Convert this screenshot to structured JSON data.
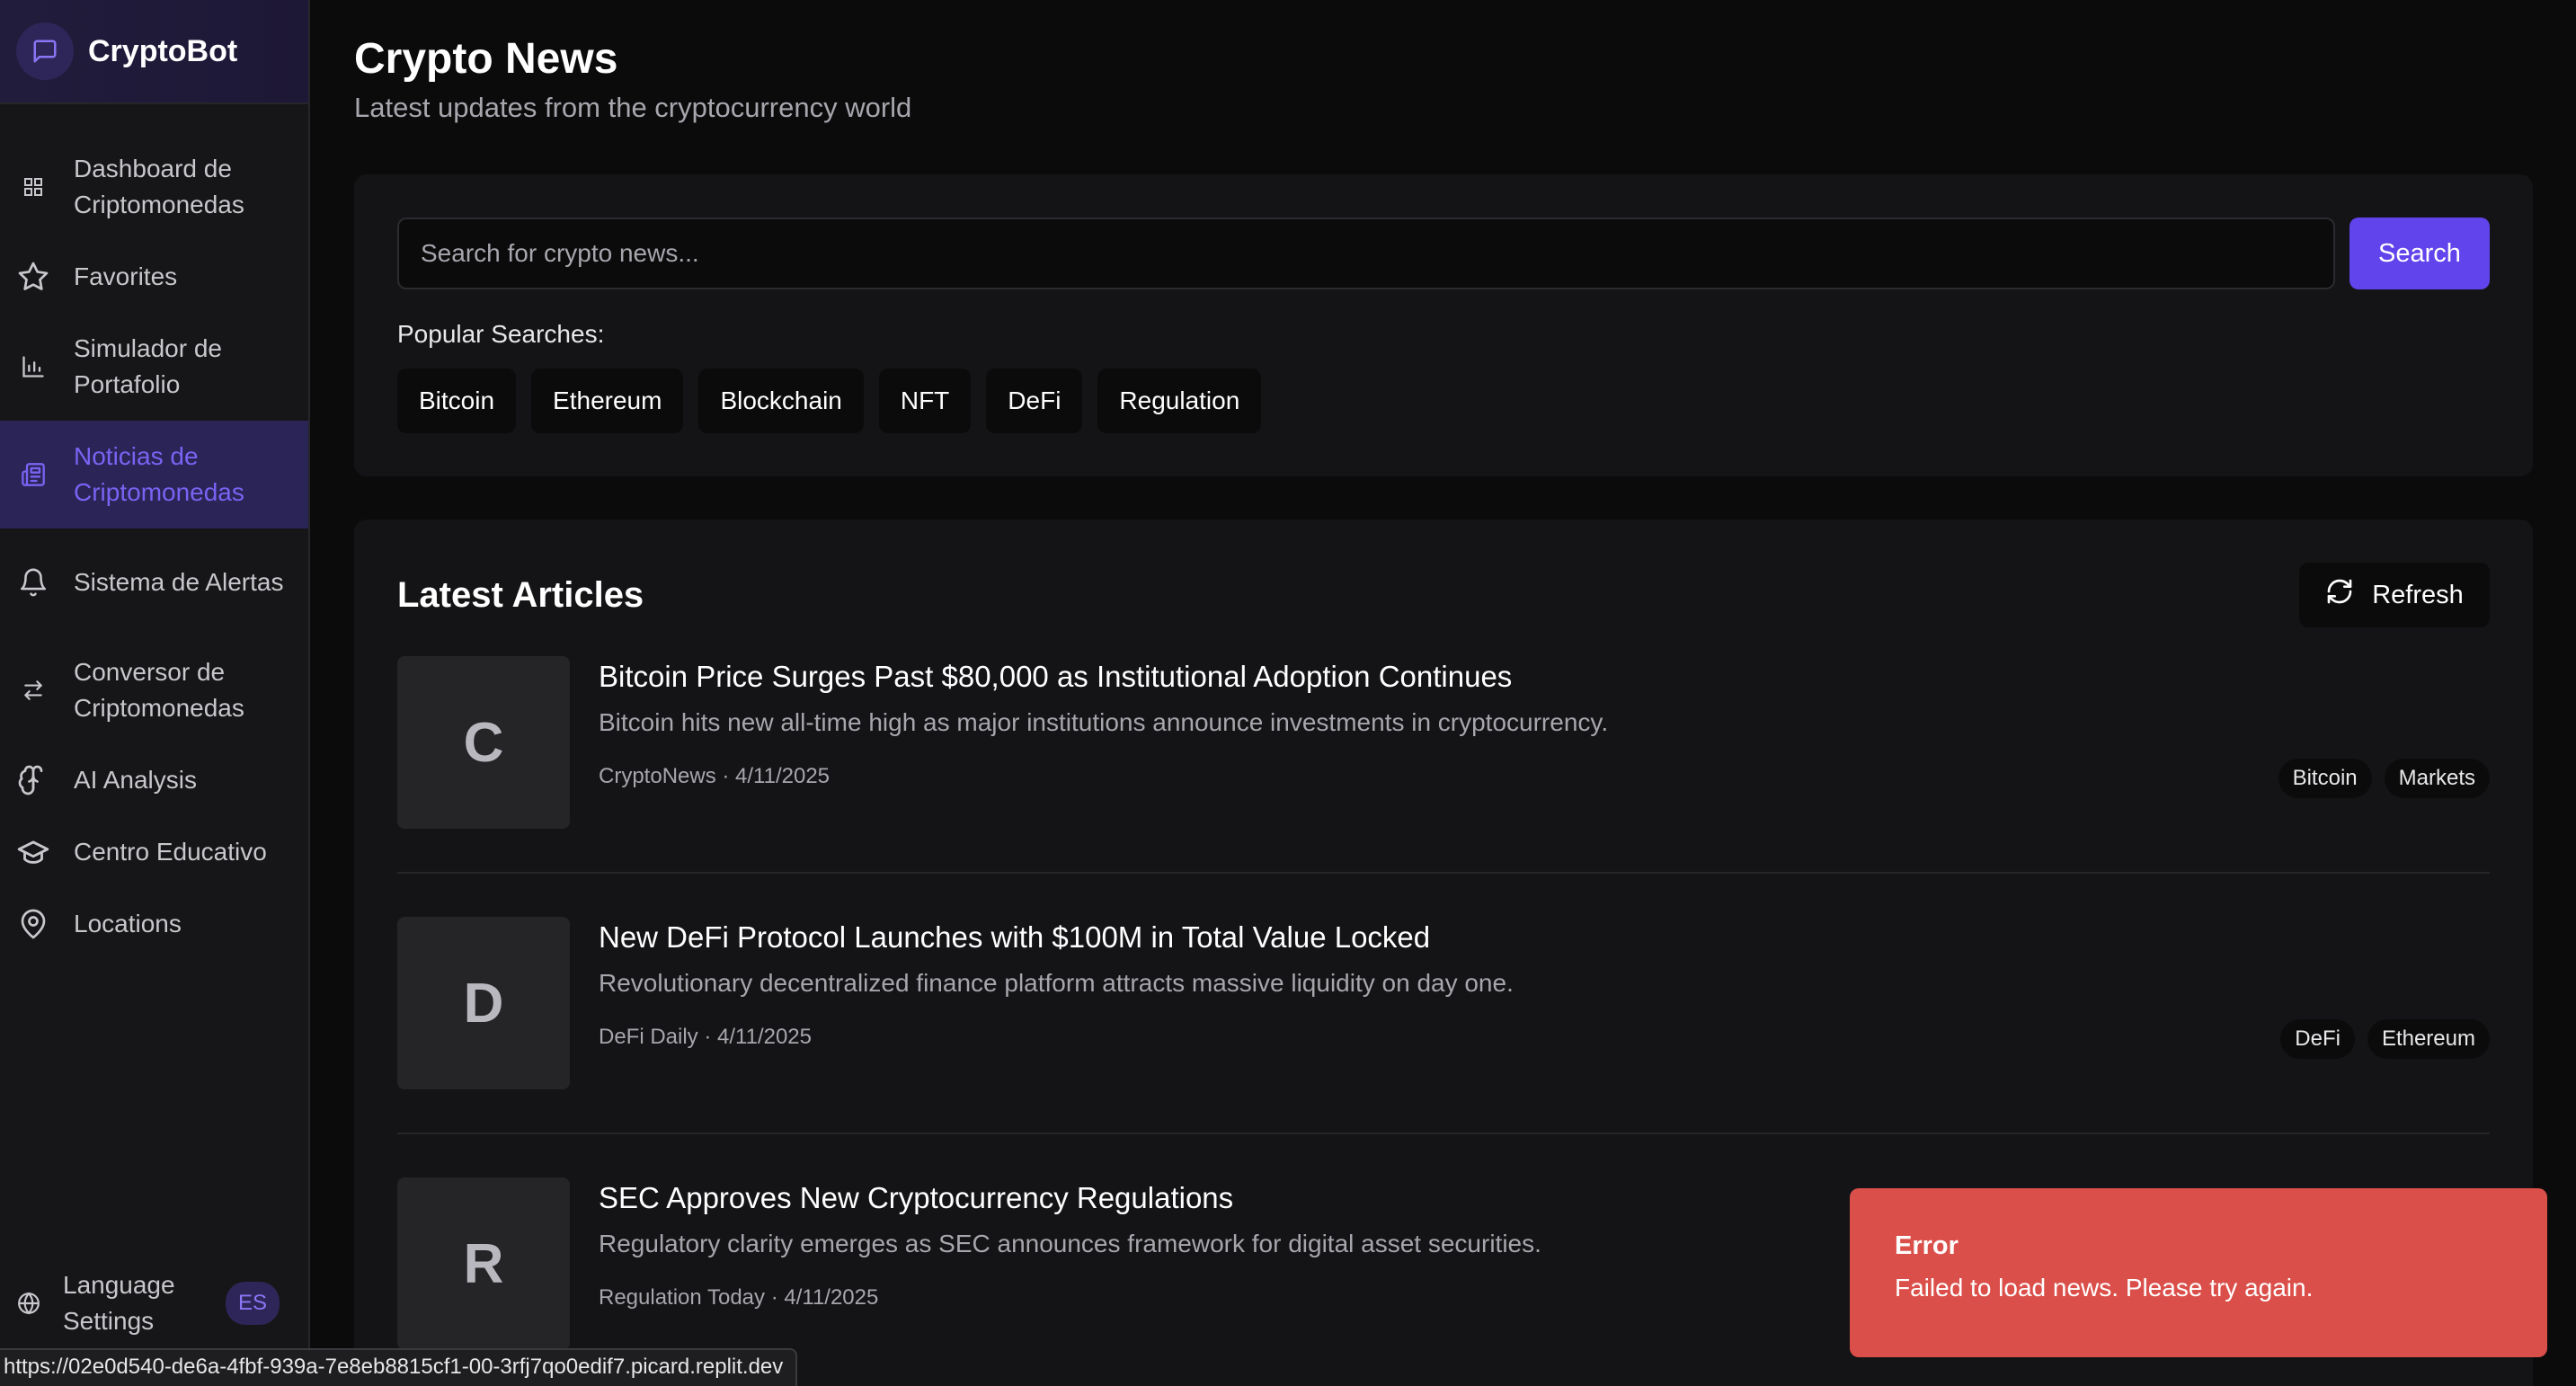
{
  "brand": {
    "name": "CryptoBot",
    "icon": "chat-bubble-icon"
  },
  "sidebar": {
    "items": [
      {
        "label": "Dashboard de Criptomonedas",
        "icon": "grid-icon",
        "active": false
      },
      {
        "label": "Favorites",
        "icon": "star-icon",
        "active": false
      },
      {
        "label": "Simulador de Portafolio",
        "icon": "bar-chart-icon",
        "active": false
      },
      {
        "label": "Noticias de Criptomonedas",
        "icon": "newspaper-icon",
        "active": true
      },
      {
        "label": "Sistema de Alertas",
        "icon": "bell-icon",
        "active": false
      },
      {
        "label": "Conversor de Criptomonedas",
        "icon": "swap-arrows-icon",
        "active": false
      },
      {
        "label": "AI Analysis",
        "icon": "brain-icon",
        "active": false
      },
      {
        "label": "Centro Educativo",
        "icon": "graduation-cap-icon",
        "active": false
      },
      {
        "label": "Locations",
        "icon": "map-pin-icon",
        "active": false
      }
    ],
    "language": {
      "label": "Language Settings",
      "badge": "ES",
      "icon": "globe-icon"
    }
  },
  "page": {
    "title": "Crypto News",
    "subtitle": "Latest updates from the cryptocurrency world"
  },
  "search": {
    "placeholder": "Search for crypto news...",
    "value": "",
    "button_label": "Search",
    "popular_label": "Popular Searches:",
    "popular": [
      "Bitcoin",
      "Ethereum",
      "Blockchain",
      "NFT",
      "DeFi",
      "Regulation"
    ]
  },
  "articles": {
    "heading": "Latest Articles",
    "refresh_label": "Refresh",
    "items": [
      {
        "initial": "C",
        "title": "Bitcoin Price Surges Past $80,000 as Institutional Adoption Continues",
        "description": "Bitcoin hits new all-time high as major institutions announce investments in cryptocurrency.",
        "meta": "CryptoNews · 4/11/2025",
        "tags": [
          "Bitcoin",
          "Markets"
        ]
      },
      {
        "initial": "D",
        "title": "New DeFi Protocol Launches with $100M in Total Value Locked",
        "description": "Revolutionary decentralized finance platform attracts massive liquidity on day one.",
        "meta": "DeFi Daily · 4/11/2025",
        "tags": [
          "DeFi",
          "Ethereum"
        ]
      },
      {
        "initial": "R",
        "title": "SEC Approves New Cryptocurrency Regulations",
        "description": "Regulatory clarity emerges as SEC announces framework for digital asset securities.",
        "meta": "Regulation Today · 4/11/2025",
        "tags": []
      }
    ]
  },
  "toast": {
    "title": "Error",
    "message": "Failed to load news. Please try again.",
    "color": "#db4f4a"
  },
  "status_bar": {
    "url": "https://02e0d540-de6a-4fbf-939a-7e8eb8815cf1-00-3rfj7qo0edif7.picard.replit.dev"
  },
  "colors": {
    "accent": "#6244ec",
    "active_nav_bg": "#2a2457",
    "active_nav_text": "#7a63f2"
  }
}
